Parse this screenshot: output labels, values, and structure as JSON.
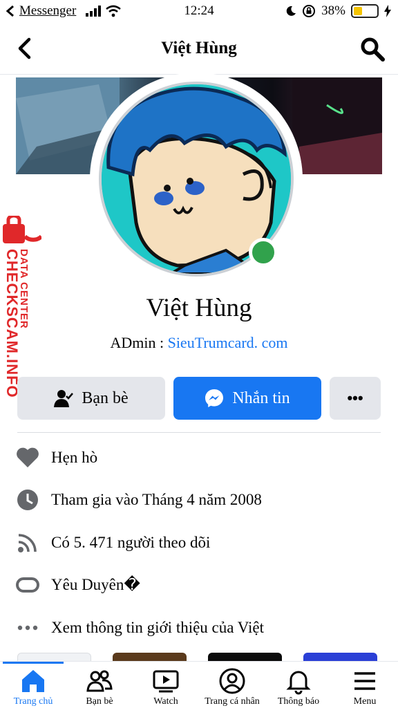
{
  "status_bar": {
    "back_app": "Messenger",
    "time": "12:24",
    "battery_percent": "38%",
    "battery_level": 0.38
  },
  "header": {
    "title": "Việt Hùng",
    "back_icon": "chevron-left-icon",
    "search_icon": "search-icon"
  },
  "profile": {
    "name": "Việt Hùng",
    "bio_prefix": "ADmin : ",
    "bio_link": "SieuTrumcard. com",
    "online": true
  },
  "watermark": {
    "line1": "DATA CENTER",
    "line2": "CHECKSCAM.INFO"
  },
  "actions": {
    "friends_label": "Bạn bè",
    "message_label": "Nhắn tin",
    "more_label": "•••"
  },
  "info": [
    {
      "icon": "heart-icon",
      "text": "Hẹn hò"
    },
    {
      "icon": "clock-icon",
      "text": "Tham gia vào Tháng 4 năm 2008"
    },
    {
      "icon": "rss-icon",
      "text": "Có 5. 471 người theo dõi"
    },
    {
      "icon": "relationship-icon",
      "text": "Yêu Duyên�"
    },
    {
      "icon": "more-dots-icon",
      "text": "Xem thông tin giới thiệu của Việt"
    }
  ],
  "tabs": [
    {
      "label": "Trang chủ",
      "icon": "home-icon",
      "active": true
    },
    {
      "label": "Bạn bè",
      "icon": "friends-icon",
      "active": false
    },
    {
      "label": "Watch",
      "icon": "watch-icon",
      "active": false
    },
    {
      "label": "Trang cá nhân",
      "icon": "profile-icon",
      "active": false
    },
    {
      "label": "Thông báo",
      "icon": "bell-icon",
      "active": false
    },
    {
      "label": "Menu",
      "icon": "menu-icon",
      "active": false
    }
  ],
  "colors": {
    "brand": "#1877f2",
    "online": "#31a24c",
    "button_gray": "#e4e6eb",
    "watermark_red": "#e0282a"
  }
}
